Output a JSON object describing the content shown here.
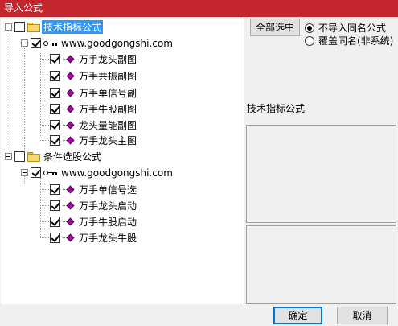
{
  "window": {
    "title": "导入公式"
  },
  "tree": {
    "groups": [
      {
        "label": "技术指标公式",
        "checked": false,
        "selected": true,
        "source": {
          "label": "www.goodgongshi.com",
          "checked": true
        },
        "items": [
          {
            "label": "万手龙头副图",
            "checked": true
          },
          {
            "label": "万手共振副图",
            "checked": true
          },
          {
            "label": "万手单信号副",
            "checked": true
          },
          {
            "label": "万手牛股副图",
            "checked": true
          },
          {
            "label": "龙头量能副图",
            "checked": true
          },
          {
            "label": "万手龙头主图",
            "checked": true
          }
        ]
      },
      {
        "label": "条件选股公式",
        "checked": false,
        "selected": false,
        "source": {
          "label": "www.goodgongshi.com",
          "checked": true
        },
        "items": [
          {
            "label": "万手单信号选",
            "checked": true
          },
          {
            "label": "万手龙头启动",
            "checked": true
          },
          {
            "label": "万手牛股启动",
            "checked": true
          },
          {
            "label": "万手龙头牛股",
            "checked": true
          }
        ]
      }
    ]
  },
  "options": {
    "select_all_label": "全部选中",
    "radio_skip_label": "不导入同名公式",
    "radio_overwrite_label": "覆盖同名(非系统)",
    "selected_radio": "skip"
  },
  "detail": {
    "type_label": "技术指标公式"
  },
  "footer": {
    "ok_label": "确定",
    "cancel_label": "取消"
  }
}
